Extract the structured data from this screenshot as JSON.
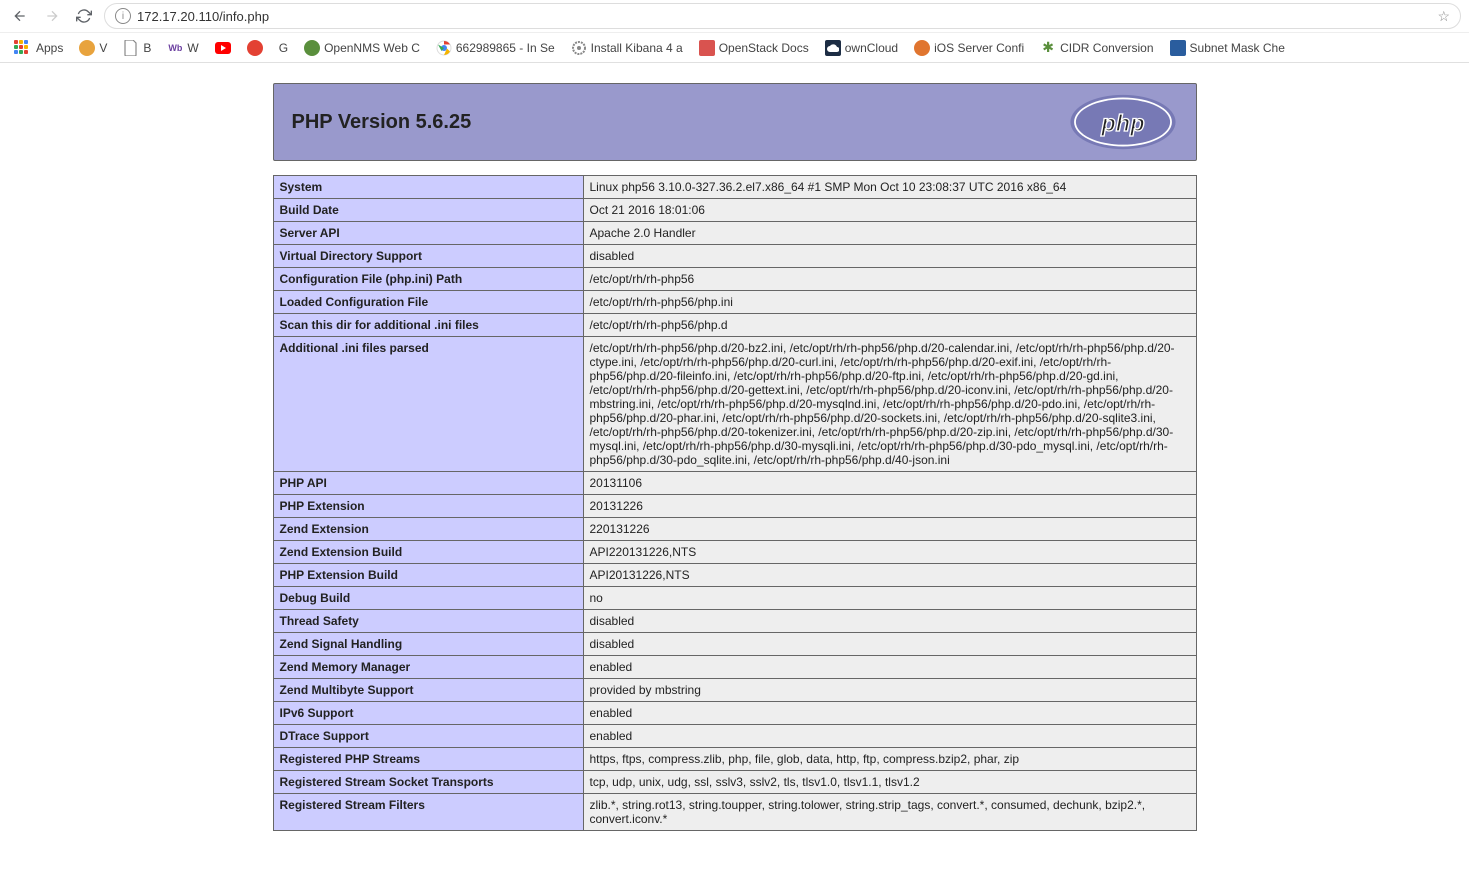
{
  "browser": {
    "url": "172.17.20.110/info.php",
    "bookmarks": [
      {
        "label": "Apps",
        "icon": "apps",
        "color": ""
      },
      {
        "label": "V",
        "icon": "circle",
        "color": "#e8a33d"
      },
      {
        "label": "B",
        "icon": "doc",
        "color": "#888"
      },
      {
        "label": "W",
        "icon": "wb",
        "color": "#6b3fa0"
      },
      {
        "label": "",
        "icon": "yt",
        "color": "#ff0000"
      },
      {
        "label": "",
        "icon": "circle",
        "color": "#e34133"
      },
      {
        "label": "G",
        "icon": "text",
        "color": "#555"
      },
      {
        "label": "OpenNMS Web C",
        "icon": "circle",
        "color": "#5a8f3c"
      },
      {
        "label": "662989865 - In Se",
        "icon": "chrome",
        "color": ""
      },
      {
        "label": "Install Kibana 4 a",
        "icon": "gear",
        "color": "#888"
      },
      {
        "label": "OpenStack Docs",
        "icon": "sq",
        "color": "#d9534f"
      },
      {
        "label": "ownCloud",
        "icon": "cloud",
        "color": "#1d2d44"
      },
      {
        "label": "iOS Server Confi",
        "icon": "circle",
        "color": "#e0752f"
      },
      {
        "label": "CIDR Conversion",
        "icon": "bug",
        "color": "#5a8f3c"
      },
      {
        "label": "Subnet Mask Che",
        "icon": "sq",
        "color": "#2a5d9e"
      }
    ]
  },
  "php": {
    "title": "PHP Version 5.6.25",
    "rows": [
      {
        "k": "System",
        "v": "Linux php56 3.10.0-327.36.2.el7.x86_64 #1 SMP Mon Oct 10 23:08:37 UTC 2016 x86_64"
      },
      {
        "k": "Build Date",
        "v": "Oct 21 2016 18:01:06"
      },
      {
        "k": "Server API",
        "v": "Apache 2.0 Handler"
      },
      {
        "k": "Virtual Directory Support",
        "v": "disabled"
      },
      {
        "k": "Configuration File (php.ini) Path",
        "v": "/etc/opt/rh/rh-php56"
      },
      {
        "k": "Loaded Configuration File",
        "v": "/etc/opt/rh/rh-php56/php.ini"
      },
      {
        "k": "Scan this dir for additional .ini files",
        "v": "/etc/opt/rh/rh-php56/php.d"
      },
      {
        "k": "Additional .ini files parsed",
        "v": "/etc/opt/rh/rh-php56/php.d/20-bz2.ini, /etc/opt/rh/rh-php56/php.d/20-calendar.ini, /etc/opt/rh/rh-php56/php.d/20-ctype.ini, /etc/opt/rh/rh-php56/php.d/20-curl.ini, /etc/opt/rh/rh-php56/php.d/20-exif.ini, /etc/opt/rh/rh-php56/php.d/20-fileinfo.ini, /etc/opt/rh/rh-php56/php.d/20-ftp.ini, /etc/opt/rh/rh-php56/php.d/20-gd.ini, /etc/opt/rh/rh-php56/php.d/20-gettext.ini, /etc/opt/rh/rh-php56/php.d/20-iconv.ini, /etc/opt/rh/rh-php56/php.d/20-mbstring.ini, /etc/opt/rh/rh-php56/php.d/20-mysqlnd.ini, /etc/opt/rh/rh-php56/php.d/20-pdo.ini, /etc/opt/rh/rh-php56/php.d/20-phar.ini, /etc/opt/rh/rh-php56/php.d/20-sockets.ini, /etc/opt/rh/rh-php56/php.d/20-sqlite3.ini, /etc/opt/rh/rh-php56/php.d/20-tokenizer.ini, /etc/opt/rh/rh-php56/php.d/20-zip.ini, /etc/opt/rh/rh-php56/php.d/30-mysql.ini, /etc/opt/rh/rh-php56/php.d/30-mysqli.ini, /etc/opt/rh/rh-php56/php.d/30-pdo_mysql.ini, /etc/opt/rh/rh-php56/php.d/30-pdo_sqlite.ini, /etc/opt/rh/rh-php56/php.d/40-json.ini"
      },
      {
        "k": "PHP API",
        "v": "20131106"
      },
      {
        "k": "PHP Extension",
        "v": "20131226"
      },
      {
        "k": "Zend Extension",
        "v": "220131226"
      },
      {
        "k": "Zend Extension Build",
        "v": "API220131226,NTS"
      },
      {
        "k": "PHP Extension Build",
        "v": "API20131226,NTS"
      },
      {
        "k": "Debug Build",
        "v": "no"
      },
      {
        "k": "Thread Safety",
        "v": "disabled"
      },
      {
        "k": "Zend Signal Handling",
        "v": "disabled"
      },
      {
        "k": "Zend Memory Manager",
        "v": "enabled"
      },
      {
        "k": "Zend Multibyte Support",
        "v": "provided by mbstring"
      },
      {
        "k": "IPv6 Support",
        "v": "enabled"
      },
      {
        "k": "DTrace Support",
        "v": "enabled"
      },
      {
        "k": "Registered PHP Streams",
        "v": "https, ftps, compress.zlib, php, file, glob, data, http, ftp, compress.bzip2, phar, zip"
      },
      {
        "k": "Registered Stream Socket Transports",
        "v": "tcp, udp, unix, udg, ssl, sslv3, sslv2, tls, tlsv1.0, tlsv1.1, tlsv1.2"
      },
      {
        "k": "Registered Stream Filters",
        "v": "zlib.*, string.rot13, string.toupper, string.tolower, string.strip_tags, convert.*, consumed, dechunk, bzip2.*, convert.iconv.*"
      }
    ]
  }
}
